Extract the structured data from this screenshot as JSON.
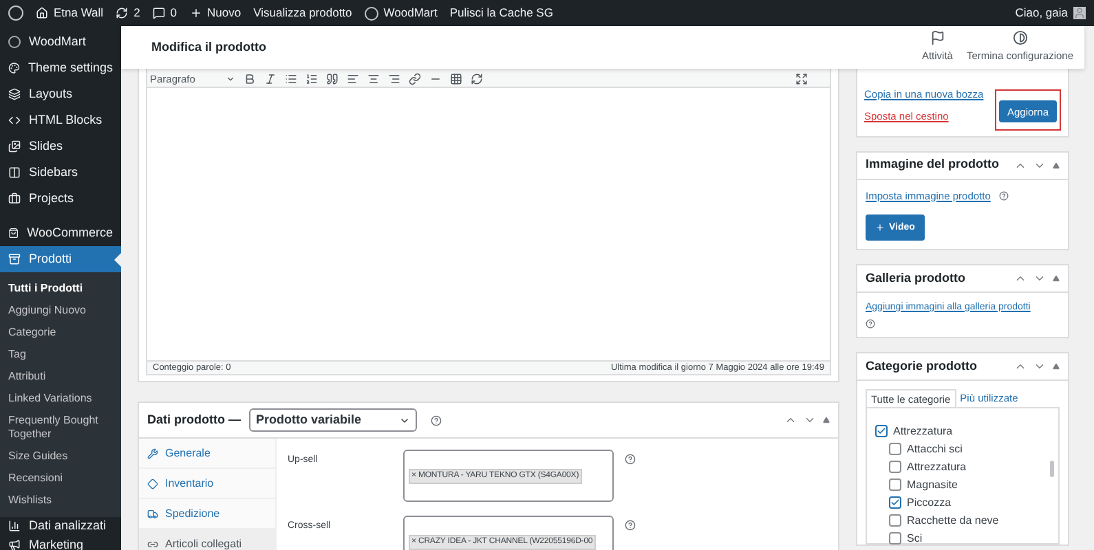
{
  "admin_bar": {
    "items": [
      {
        "kind": "wp"
      },
      {
        "kind": "site",
        "label": "Etna Wall"
      },
      {
        "kind": "updates",
        "label": "2"
      },
      {
        "kind": "comments",
        "label": "0"
      },
      {
        "kind": "new",
        "label": "Nuovo"
      },
      {
        "kind": "link",
        "label": "Visualizza prodotto"
      },
      {
        "kind": "woodmart",
        "label": "WoodMart"
      },
      {
        "kind": "link",
        "label": "Pulisci la Cache SG"
      }
    ],
    "greeting": "Ciao, gaia"
  },
  "sidebar": {
    "items": [
      {
        "label": "WoodMart",
        "selected": false
      },
      {
        "label": "Theme settings",
        "selected": false
      },
      {
        "label": "Layouts",
        "selected": false
      },
      {
        "label": "HTML Blocks",
        "selected": false
      },
      {
        "label": "Slides",
        "selected": false
      },
      {
        "label": "Sidebars",
        "selected": false
      },
      {
        "label": "Projects",
        "selected": false
      },
      {
        "label": "WooCommerce",
        "selected": false
      },
      {
        "label": "Prodotti",
        "selected": true
      }
    ],
    "submenu": [
      {
        "label": "Tutti i Prodotti",
        "selected": true
      },
      {
        "label": "Aggiungi Nuovo",
        "selected": false
      },
      {
        "label": "Categorie",
        "selected": false
      },
      {
        "label": "Tag",
        "selected": false
      },
      {
        "label": "Attributi",
        "selected": false
      },
      {
        "label": "Linked Variations",
        "selected": false
      },
      {
        "label": "Frequently Bought Together",
        "selected": false
      },
      {
        "label": "Size Guides",
        "selected": false
      },
      {
        "label": "Recensioni",
        "selected": false
      },
      {
        "label": "Wishlists",
        "selected": false
      }
    ],
    "bottom_items": [
      {
        "label": "Dati analizzati",
        "selected": false
      },
      {
        "label": "Marketing",
        "selected": false
      }
    ]
  },
  "header": {
    "title": "Modifica il prodotto",
    "actions": [
      "Attività",
      "Termina configurazione"
    ]
  },
  "editor": {
    "format": "Paragrafo",
    "word_count": "Conteggio parole: 0",
    "last_modified": "Ultima modifica il giorno 7 Maggio 2024 alle ore 19:49"
  },
  "product_data": {
    "title": "Dati prodotto —",
    "type": "Prodotto variabile",
    "tabs": [
      {
        "label": "Generale",
        "selected": false
      },
      {
        "label": "Inventario",
        "selected": false
      },
      {
        "label": "Spedizione",
        "selected": false
      },
      {
        "label": "Articoli collegati",
        "selected": true
      }
    ],
    "fields": [
      {
        "label": "Up-sell",
        "tag": "× MONTURA - YARU TEKNO GTX (S4GA00X)"
      },
      {
        "label": "Cross-sell",
        "tag": "× CRAZY IDEA - JKT CHANNEL (W22055196D-00"
      }
    ]
  },
  "publish": {
    "links": [
      "Copia in una nuova bozza",
      "Sposta nel cestino"
    ],
    "button": "Aggiorna"
  },
  "product_image": {
    "title": "Immagine del prodotto",
    "link": "Imposta immagine prodotto",
    "button": "Video"
  },
  "gallery": {
    "title": "Galleria prodotto",
    "link": "Aggiungi immagini alla galleria prodotti"
  },
  "categories": {
    "title": "Categorie prodotto",
    "tabs": [
      {
        "label": "Tutte le categorie",
        "selected": true
      },
      {
        "label": "Più utilizzate",
        "selected": false
      }
    ],
    "items": [
      {
        "label": "Attrezzatura",
        "checked": true,
        "children": [
          {
            "label": "Attacchi sci",
            "checked": false
          },
          {
            "label": "Attrezzatura",
            "checked": false
          },
          {
            "label": "Magnasite",
            "checked": false
          },
          {
            "label": "Piccozza",
            "checked": true
          },
          {
            "label": "Racchette da neve",
            "checked": false
          },
          {
            "label": "Sci",
            "checked": false
          }
        ]
      }
    ]
  }
}
